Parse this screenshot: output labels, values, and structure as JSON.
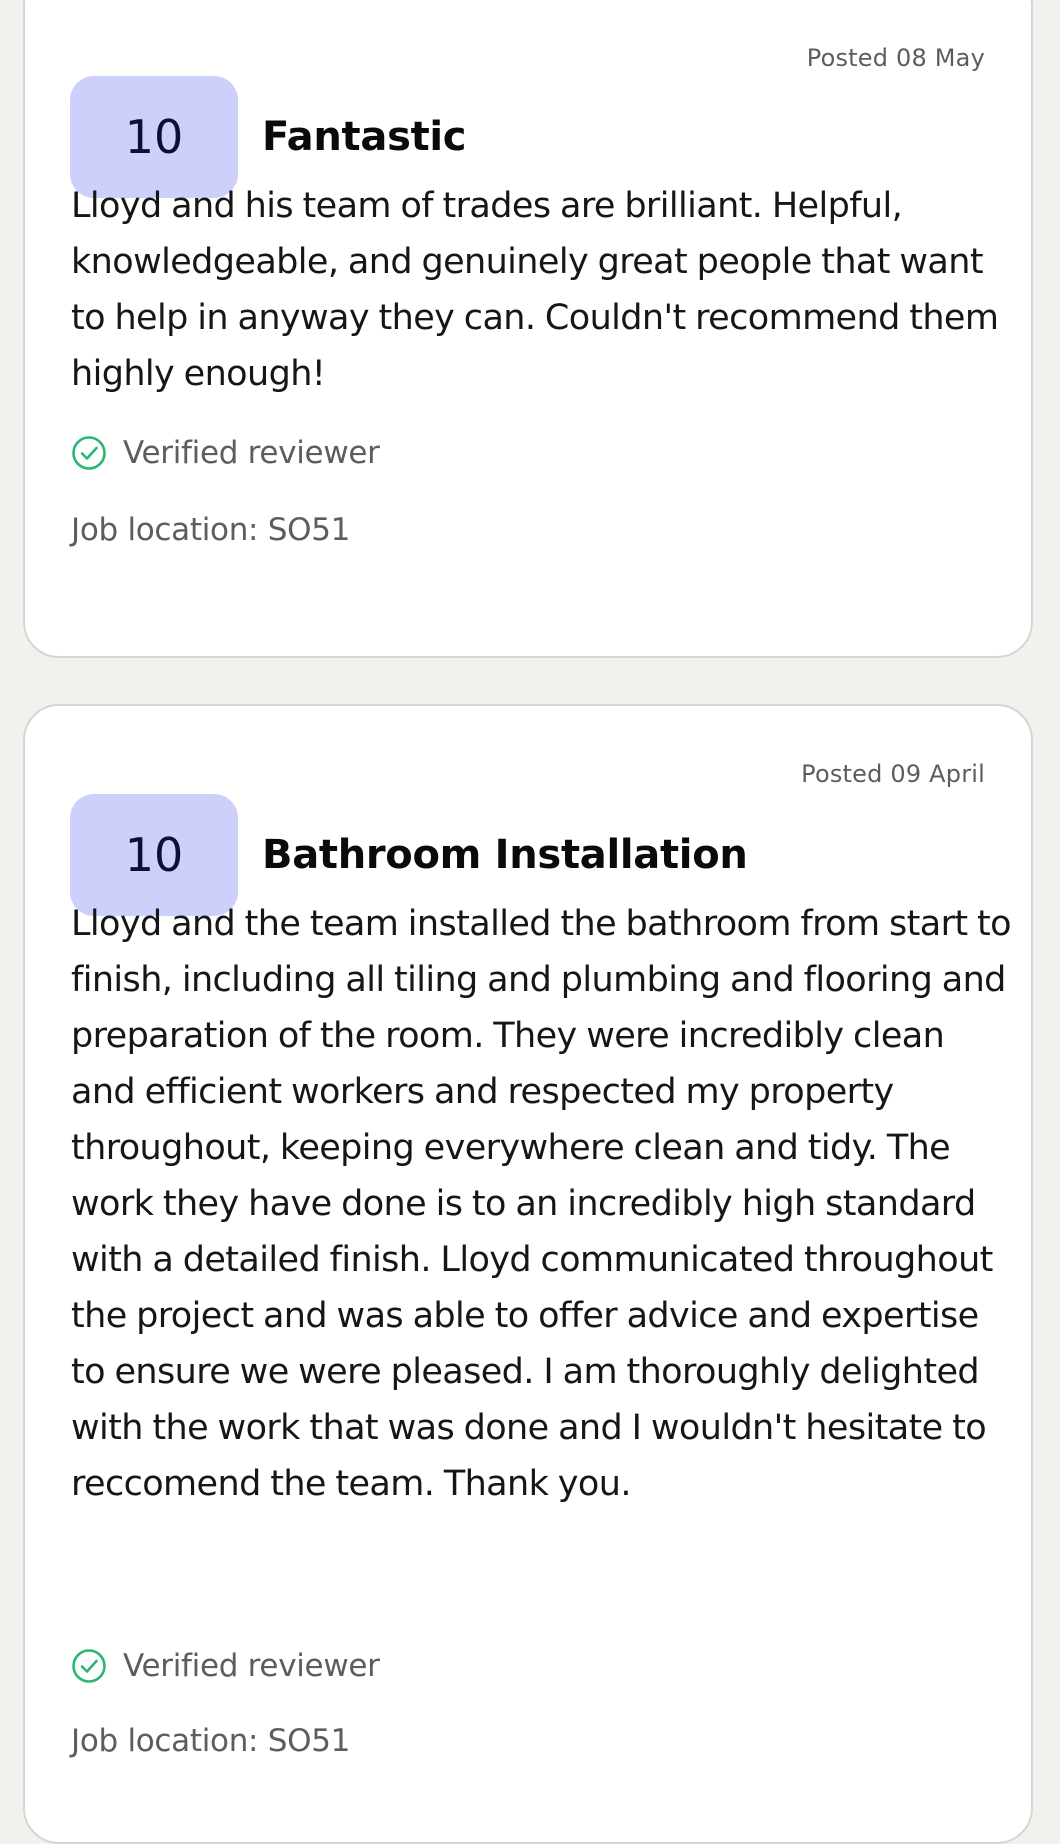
{
  "reviews": [
    {
      "posted": "Posted 08 May",
      "score": "10",
      "title": "Fantastic",
      "body": "Lloyd and his team of trades are brilliant. Helpful, knowledgeable, and genuinely great people that want to help in anyway they can. Couldn't recommend them highly enough!",
      "verified_label": "Verified reviewer",
      "job_location": "Job location: SO51"
    },
    {
      "posted": "Posted 09 April",
      "score": "10",
      "title": "Bathroom Installation",
      "body": "Lloyd and the team installed the bathroom from start to finish, including all tiling and plumbing and flooring and preparation of the room. They were incredibly clean and efficient workers and respected my property throughout, keeping everywhere clean and tidy. The work they have done is to an incredibly high standard with a detailed finish. Lloyd communicated throughout the project and was able to offer advice and expertise to ensure we were pleased. I am thoroughly delighted with the work that was done and I wouldn't hesitate to reccomend the team. Thank you.",
      "verified_label": "Verified reviewer",
      "job_location": "Job location: SO51"
    }
  ],
  "colors": {
    "page_background": "#f2f1ee",
    "card_background": "#ffffff",
    "score_badge": "#cdd0fb",
    "verified_green": "#2bb673",
    "muted_text": "#5d5d5d"
  },
  "icons": {
    "verified": "check-circle-icon"
  }
}
